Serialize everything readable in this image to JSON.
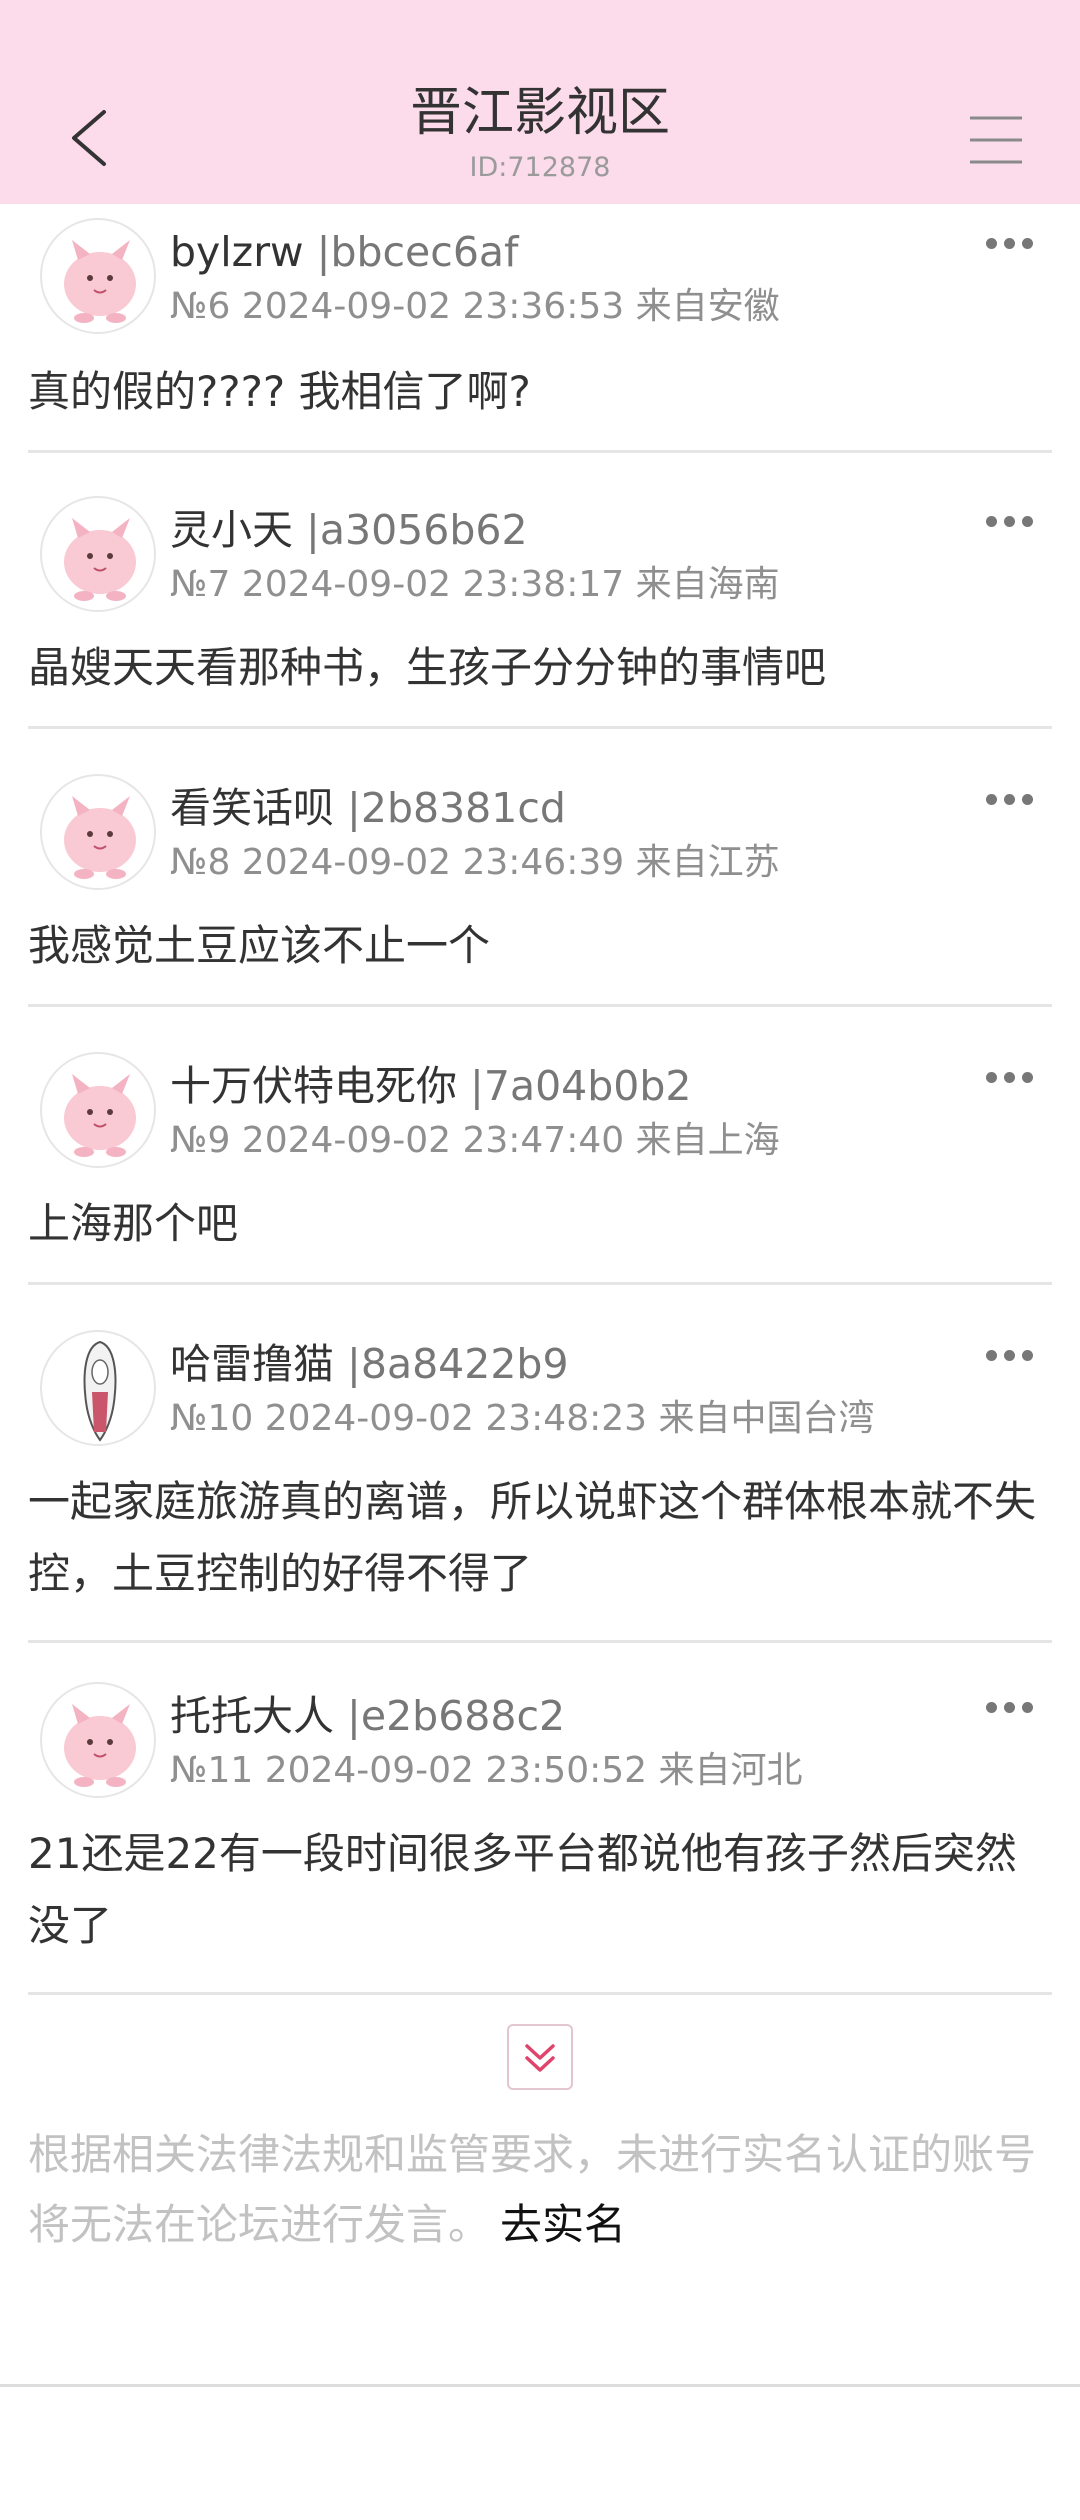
{
  "header": {
    "title": "晋江影视区",
    "subtitle": "ID:712878",
    "back_icon": "chevron-left-icon",
    "menu_icon": "hamburger-menu-icon",
    "background_color": "#fcdcea"
  },
  "posts": [
    {
      "username": "bylzrw",
      "user_id": "|bbcec6af",
      "meta": "№6 2024-09-02 23:36:53 来自安徽",
      "content": "真的假的????  我相信了啊?",
      "avatar": "pink-creature-avatar"
    },
    {
      "username": "灵小天",
      "user_id": "|a3056b62",
      "meta": "№7 2024-09-02 23:38:17 来自海南",
      "content": "晶嫂天天看那种书，生孩子分分钟的事情吧",
      "avatar": "pink-creature-avatar"
    },
    {
      "username": "看笑话呗",
      "user_id": "|2b8381cd",
      "meta": "№8 2024-09-02 23:46:39 来自江苏",
      "content": "我感觉土豆应该不止一个",
      "avatar": "pink-creature-avatar"
    },
    {
      "username": "十万伏特电死你",
      "user_id": "|7a04b0b2",
      "meta": "№9 2024-09-02 23:47:40 来自上海",
      "content": "上海那个吧",
      "avatar": "pink-creature-avatar"
    },
    {
      "username": "哈雷撸猫",
      "user_id": "|8a8422b9",
      "meta": "№10 2024-09-02 23:48:23 来自中国台湾",
      "content": "一起家庭旅游真的离谱，所以说虾这个群体根本就不失控，土豆控制的好得不得了",
      "avatar": "hooded-figure-avatar"
    },
    {
      "username": "托托大人",
      "user_id": "|e2b688c2",
      "meta": "№11 2024-09-02 23:50:52 来自河北",
      "content": "21还是22有一段时间很多平台都说他有孩子然后突然没了",
      "avatar": "pink-creature-avatar"
    }
  ],
  "more_icon": "ellipsis-icon",
  "expand_icon": "double-chevron-down-icon",
  "notice": {
    "text": "根据相关法律法规和监管要求，未进行实名认证的账号将无法在论坛进行发言。",
    "link": "去实名"
  }
}
